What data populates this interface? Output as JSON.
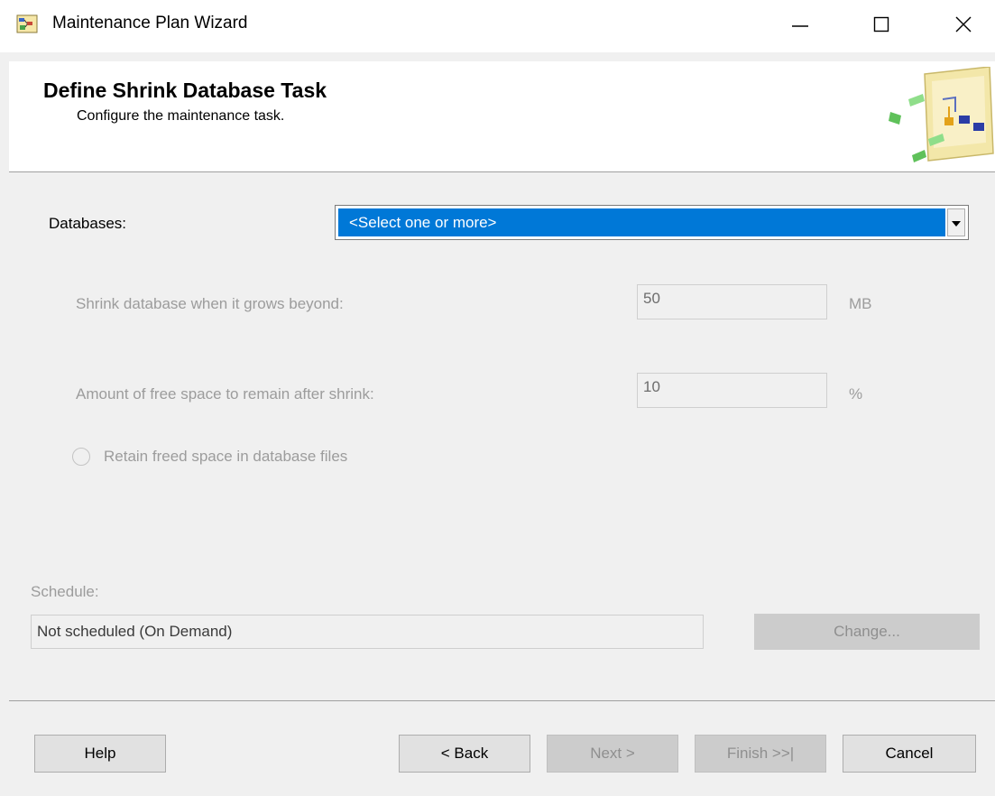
{
  "window": {
    "title": "Maintenance Plan Wizard",
    "icons": {
      "app": "maintenance-plan-icon",
      "minimize": "minimize-icon",
      "maximize": "maximize-icon",
      "close": "close-icon"
    }
  },
  "header": {
    "title": "Define Shrink Database Task",
    "subtitle": "Configure the maintenance task.",
    "graphic": "wizard-flow-graphic"
  },
  "form": {
    "databases_label": "Databases:",
    "databases_value": "<Select one or more>",
    "shrink_label": "Shrink database when it grows beyond:",
    "shrink_value": "50",
    "shrink_unit": "MB",
    "free_space_label": "Amount of free space to remain after shrink:",
    "free_space_value": "10",
    "free_space_unit": "%",
    "retain_label": "Retain freed space in database files",
    "retain_selected": false
  },
  "schedule": {
    "label": "Schedule:",
    "value": "Not scheduled (On Demand)",
    "change_label": "Change..."
  },
  "footer": {
    "help": "Help",
    "back": "< Back",
    "next": "Next >",
    "finish": "Finish >>|",
    "cancel": "Cancel"
  },
  "colors": {
    "selection": "#0078d7",
    "window_bg": "#f0f0f0",
    "disabled_text": "#9c9c9c"
  }
}
